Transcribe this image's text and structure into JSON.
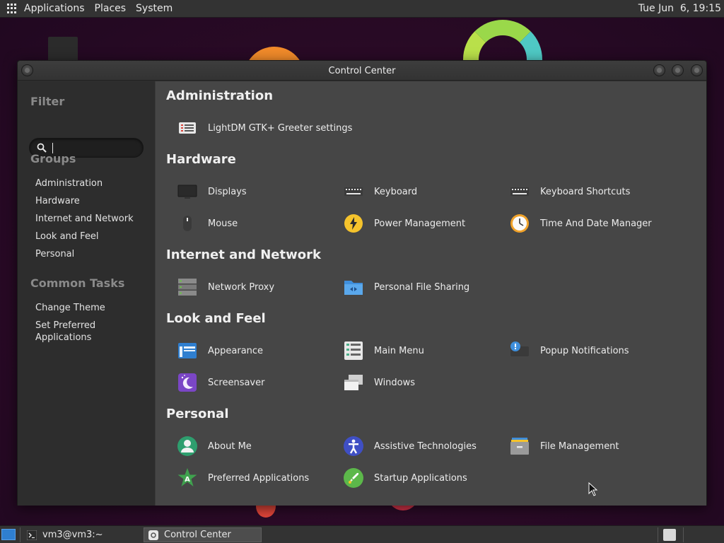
{
  "top_panel": {
    "menus": [
      "Applications",
      "Places",
      "System"
    ],
    "clock": "Tue Jun  6, 19:15"
  },
  "window": {
    "title": "Control Center"
  },
  "sidebar": {
    "filter_heading": "Filter",
    "search_value": "",
    "groups_heading": "Groups",
    "groups": [
      "Administration",
      "Hardware",
      "Internet and Network",
      "Look and Feel",
      "Personal"
    ],
    "tasks_heading": "Common Tasks",
    "tasks": [
      "Change Theme",
      "Set Preferred Applications"
    ]
  },
  "groups": [
    {
      "title": "Administration",
      "items": [
        {
          "label": "LightDM GTK+ Greeter settings",
          "icon": "greeter-settings-icon"
        }
      ]
    },
    {
      "title": "Hardware",
      "items": [
        {
          "label": "Displays",
          "icon": "display-icon"
        },
        {
          "label": "Keyboard",
          "icon": "keyboard-icon"
        },
        {
          "label": "Keyboard Shortcuts",
          "icon": "keyboard-shortcuts-icon"
        },
        {
          "label": "Mouse",
          "icon": "mouse-icon"
        },
        {
          "label": "Power Management",
          "icon": "power-icon"
        },
        {
          "label": "Time And Date Manager",
          "icon": "clock-icon"
        }
      ]
    },
    {
      "title": "Internet and Network",
      "items": [
        {
          "label": "Network Proxy",
          "icon": "network-proxy-icon"
        },
        {
          "label": "Personal File Sharing",
          "icon": "file-sharing-icon"
        }
      ]
    },
    {
      "title": "Look and Feel",
      "items": [
        {
          "label": "Appearance",
          "icon": "appearance-icon"
        },
        {
          "label": "Main Menu",
          "icon": "main-menu-icon"
        },
        {
          "label": "Popup Notifications",
          "icon": "notification-icon"
        },
        {
          "label": "Screensaver",
          "icon": "screensaver-icon"
        },
        {
          "label": "Windows",
          "icon": "windows-icon"
        }
      ]
    },
    {
      "title": "Personal",
      "items": [
        {
          "label": "About Me",
          "icon": "about-me-icon"
        },
        {
          "label": "Assistive Technologies",
          "icon": "accessibility-icon"
        },
        {
          "label": "File Management",
          "icon": "file-management-icon"
        },
        {
          "label": "Preferred Applications",
          "icon": "preferred-apps-icon"
        },
        {
          "label": "Startup Applications",
          "icon": "startup-apps-icon"
        }
      ]
    }
  ],
  "taskbar": {
    "tasks": [
      {
        "label": "vm3@vm3:~",
        "icon": "terminal-icon"
      },
      {
        "label": "Control Center",
        "icon": "control-center-icon"
      }
    ]
  }
}
